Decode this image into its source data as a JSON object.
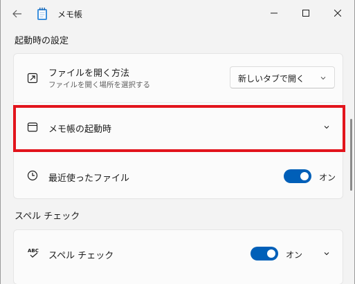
{
  "window": {
    "title": "メモ帳",
    "icons": {
      "back": "back-arrow-icon",
      "app": "notepad-app-icon",
      "minimize": "minimize-icon",
      "maximize": "maximize-icon",
      "close": "close-icon"
    }
  },
  "sections": {
    "startup": {
      "heading": "起動時の設定",
      "open_files": {
        "title": "ファイルを開く方法",
        "subtitle": "ファイルを開く場所を選択する",
        "icon": "open-in-window-icon",
        "dropdown_value": "新しいタブで開く"
      },
      "notepad_startup": {
        "title": "メモ帳の起動時",
        "icon": "window-icon"
      },
      "recent_files": {
        "title": "最近使ったファイル",
        "icon": "clock-icon",
        "toggle_state": "オン",
        "toggle_on": true
      }
    },
    "spellcheck": {
      "heading": "スペル チェック",
      "spell_check": {
        "title": "スペル チェック",
        "icon": "spellcheck-abc-icon",
        "toggle_state": "オン",
        "toggle_on": true
      }
    }
  },
  "colors": {
    "accent": "#005fb8",
    "highlight": "#e2141c"
  }
}
